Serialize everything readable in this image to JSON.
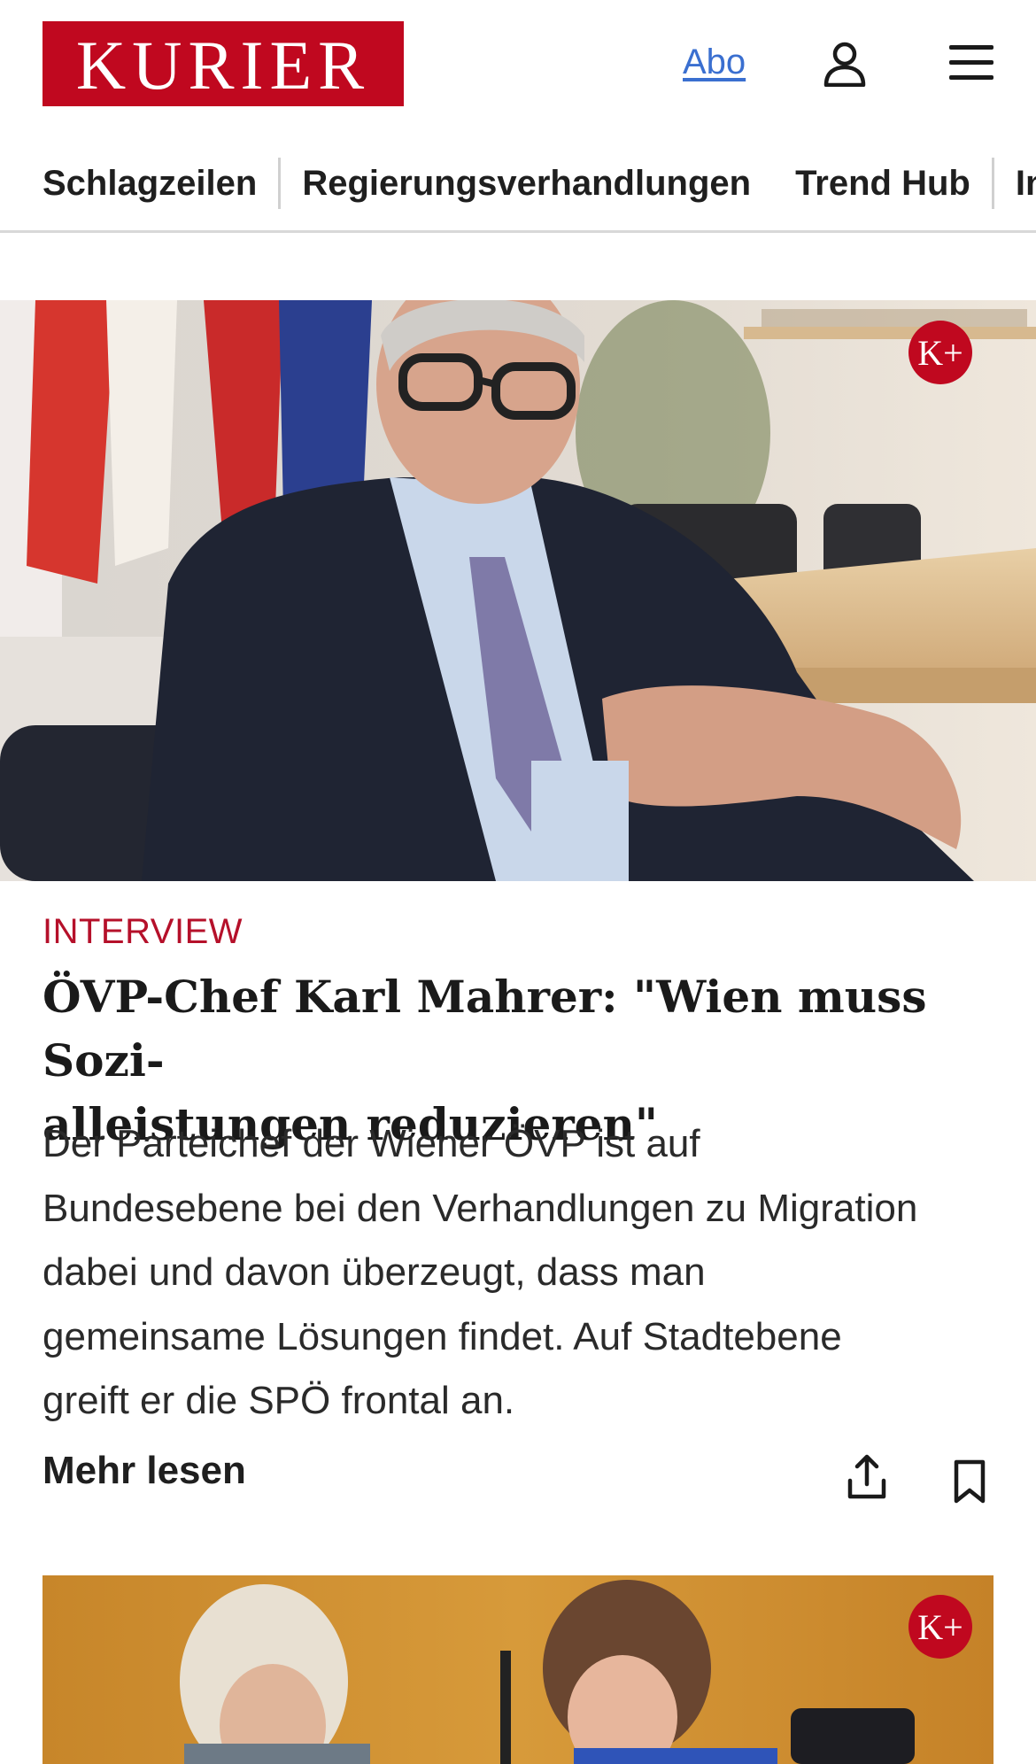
{
  "header": {
    "logo_text": "KURIER",
    "abo_label": "Abo",
    "icons": [
      "user-icon",
      "menu-icon"
    ]
  },
  "nav": {
    "items": [
      {
        "label": "Schlagzeilen"
      },
      {
        "label": "Regierungsverhandlungen"
      },
      {
        "label": "Trend Hub"
      },
      {
        "label": "In"
      }
    ]
  },
  "article": {
    "badge": "K+",
    "kicker": "INTERVIEW",
    "headline_line1": "ÖVP-Chef Karl Mahrer: \"Wien muss Sozi-",
    "headline_line2": "alleistungen reduzieren\"",
    "teaser_lines": [
      "Der Parteichef der Wiener ÖVP ist auf",
      "Bundesebene bei den Verhandlungen zu Migration",
      "dabei und davon überzeugt, dass man",
      "gemeinsame Lösungen findet. Auf Stadtebene",
      "greift er die SPÖ frontal an."
    ],
    "more_label": "Mehr lesen",
    "icons": [
      "share-icon",
      "bookmark-icon"
    ]
  },
  "next_card": {
    "badge": "K+"
  },
  "colors": {
    "brand_red": "#c0081f",
    "kicker_red": "#b5102a",
    "link_blue": "#3a6fd0"
  }
}
